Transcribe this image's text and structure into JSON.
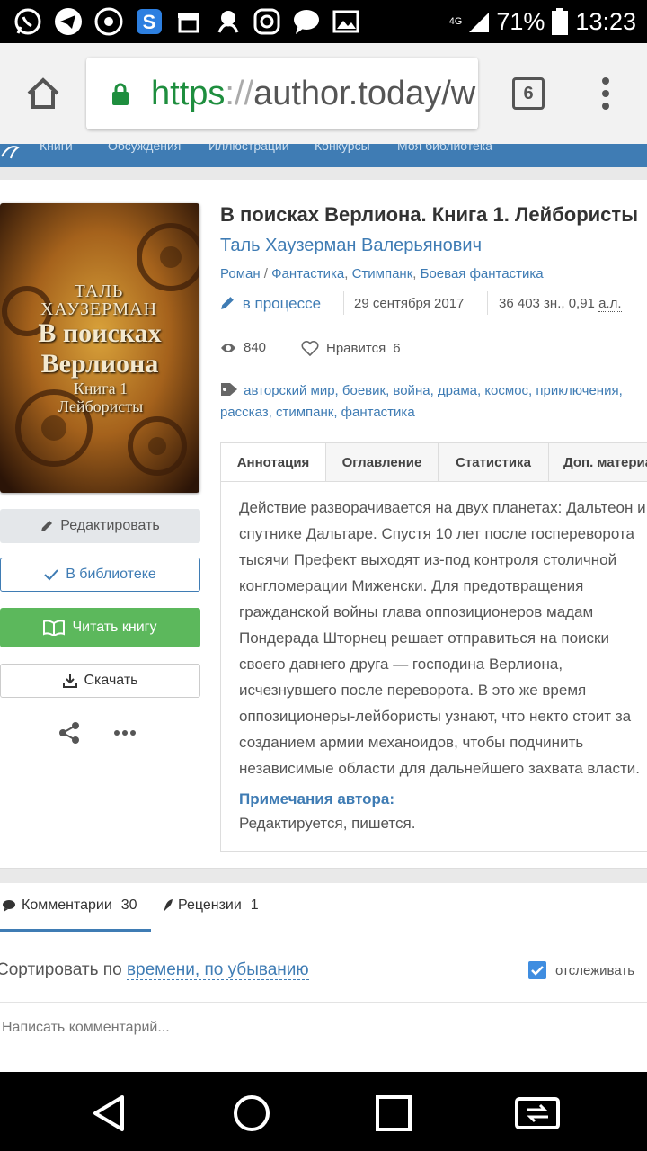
{
  "status_bar": {
    "network": "4G",
    "battery": "71%",
    "time": "13:23"
  },
  "browser": {
    "url_scheme": "https",
    "url_sep": "://",
    "url_host": "author.today/w",
    "tab_count": "6"
  },
  "site_nav": {
    "items": [
      "Книги",
      "Обсуждения",
      "Иллюстрации",
      "Конкурсы",
      "Моя библиотека"
    ]
  },
  "book": {
    "cover_author": "ТАЛЬ ХАУЗЕРМАН",
    "cover_title": "В поисках Верлиона",
    "cover_subtitle": "Книга 1 Лейбористы",
    "title": "В поисках Верлиона. Книга 1. Лейбористы",
    "author": "Таль Хаузерман Валерьянович",
    "genre_form": "Роман",
    "genre_sep": " / ",
    "genres": [
      "Фантастика",
      "Стимпанк",
      "Боевая фантастика"
    ],
    "status": "в процессе",
    "date": "29 сентября 2017",
    "size": "36 403 зн., 0,91",
    "size_unit": "а.л.",
    "views": "840",
    "likes_label": "Нравится",
    "likes": "6",
    "tags_line1": "авторский мир, боевик, война, драма, космос, приключения,",
    "tags_line2": "рассказ, стимпанк, фантастика"
  },
  "actions": {
    "edit": "Редактировать",
    "library": "В библиотеке",
    "read": "Читать книгу",
    "download": "Скачать"
  },
  "tabs": [
    "Аннотация",
    "Оглавление",
    "Статистика",
    "Доп. материалы"
  ],
  "annotation": {
    "lines": [
      "Действие разворачивается на двух планетах: Дальтеон и",
      "спутнике Дальтаре. Спустя 10 лет после госпереворота",
      "тысячи Префект выходят из-под контроля столичной",
      "конгломерации Миженски. Для предотвращения",
      "гражданской войны глава оппозиционеров мадам",
      "Пондерада Шторнец решает отправиться на поиски",
      "своего давнего друга — господина Верлиона,",
      "исчезнувшего после переворота. В это же время",
      "оппозиционеры-лейбористы узнают, что некто стоит за",
      "созданием армии механоидов, чтобы подчинить",
      "независимые области для дальнейшего захвата власти."
    ],
    "notes_title": "Примечания автора:",
    "notes_text": "Редактируется, пишется."
  },
  "comments": {
    "tab_comments": "Комментарии",
    "comments_count": "30",
    "tab_reviews": "Рецензии",
    "reviews_count": "1",
    "sort_prefix": "Сортировать по",
    "sort_field": "времени, по убыванию",
    "track_label": "отслеживать",
    "placeholder": "Написать комментарий..."
  },
  "colors": {
    "link": "#3f7cb4",
    "read_button": "#5cb85c",
    "url_green": "#1e8e3e"
  }
}
